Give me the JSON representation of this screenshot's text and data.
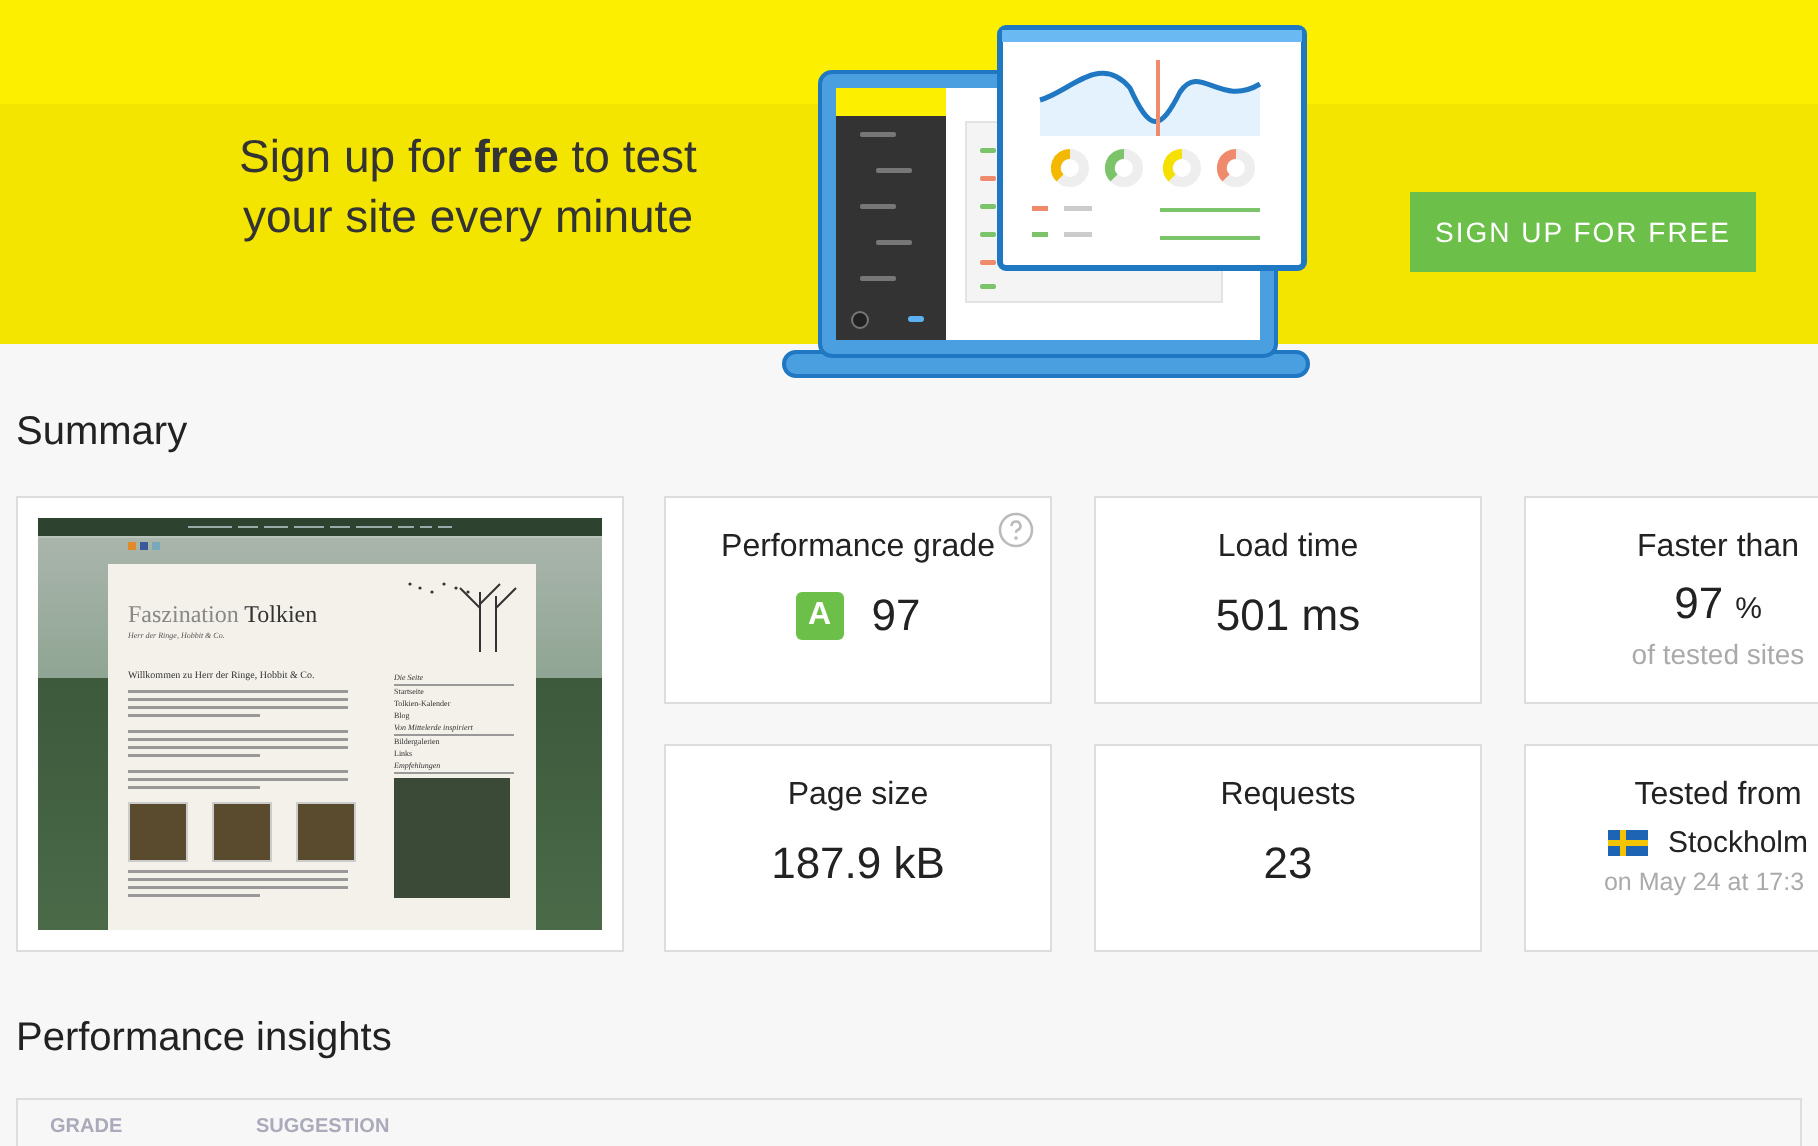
{
  "banner": {
    "headline": "Sign up for **free** to test your site every minute",
    "button": "SIGN UP FOR FREE"
  },
  "summary": {
    "title": "Summary",
    "screenshot": {
      "site_title_light": "Faszination",
      "site_title_bold": "Tolkien",
      "site_subtitle": "Herr der Ringe, Hobbit & Co.",
      "heading": "Willkommen zu Herr der Ringe, Hobbit & Co.",
      "sidebar": [
        {
          "kind": "heading",
          "label": "Die Seite"
        },
        {
          "kind": "link",
          "label": "Startseite"
        },
        {
          "kind": "link",
          "label": "Tolkien-Kalender"
        },
        {
          "kind": "link",
          "label": "Blog"
        },
        {
          "kind": "heading",
          "label": "Von Mittelerde inspiriert"
        },
        {
          "kind": "link",
          "label": "Bildergalerien"
        },
        {
          "kind": "link",
          "label": "Links"
        },
        {
          "kind": "heading",
          "label": "Empfehlungen"
        }
      ]
    },
    "metrics": [
      {
        "kind": "grade",
        "label": "Performance grade",
        "grade": "A",
        "value": "97"
      },
      {
        "kind": "plain",
        "label": "Load time",
        "value": "501 ms"
      },
      {
        "kind": "percent",
        "label": "Faster than",
        "value": "97",
        "unit": "%",
        "note": "of tested sites"
      },
      {
        "kind": "plain",
        "label": "Page size",
        "value": "187.9 kB"
      },
      {
        "kind": "plain",
        "label": "Requests",
        "value": "23"
      },
      {
        "kind": "location",
        "label": "Tested from",
        "value": "Stockholm",
        "note": "on May 24 at 17:3"
      }
    ]
  },
  "insights": {
    "title": "Performance insights",
    "columns": [
      "GRADE",
      "SUGGESTION"
    ]
  }
}
